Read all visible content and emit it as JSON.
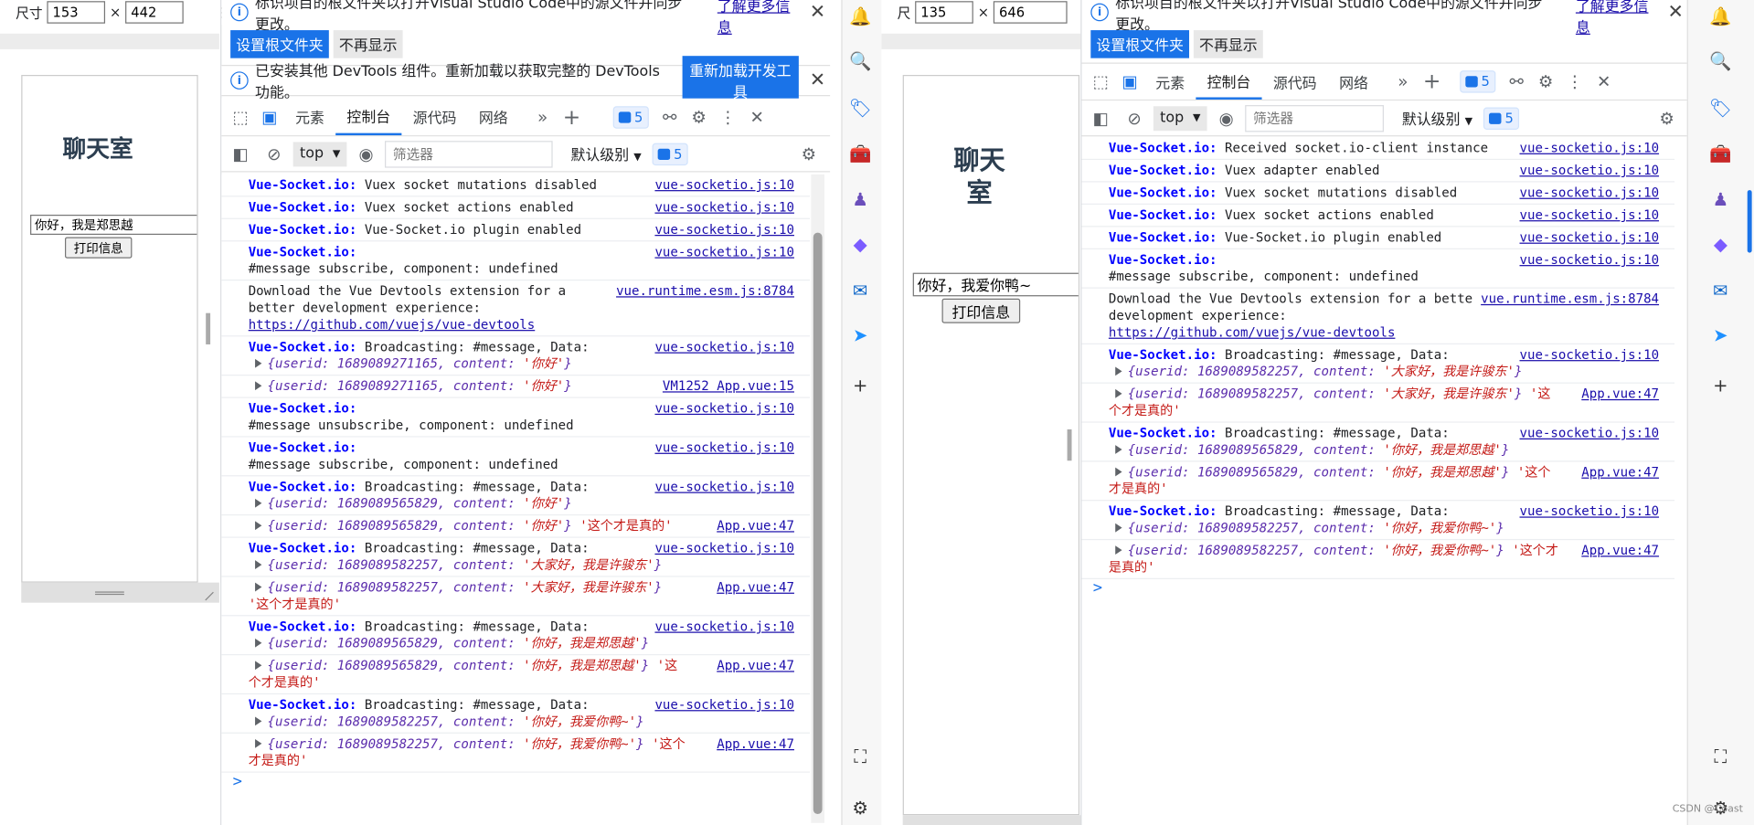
{
  "left_window": {
    "dim_label": "尺寸",
    "width": "153",
    "height": "442",
    "chat": {
      "title": "聊天室",
      "input_value": "你好，我是郑思越",
      "button": "打印信息"
    },
    "info1": {
      "text": "标识项目的根文件夹以打开Visual Studio Code中的源文件并同步更改。",
      "learn_more": "了解更多信息",
      "primary": "设置根文件夹",
      "secondary": "不再显示"
    },
    "info2": {
      "text": "已安装其他 DevTools 组件。重新加载以获取完整的 DevTools 功能。",
      "primary": "重新加载开发工具"
    },
    "tabs": [
      "元素",
      "控制台",
      "源代码",
      "网络"
    ],
    "active_tab": "控制台",
    "badge": "5",
    "context": "top",
    "filter_placeholder": "筛选器",
    "level": "默认级别",
    "filter_badge": "5",
    "console": [
      {
        "parts": [
          {
            "c": "vsio",
            "t": "Vue-Socket.io:"
          },
          {
            "c": "",
            "t": " Vuex socket mutations disabled"
          }
        ],
        "src": "vue-socketio.js:10"
      },
      {
        "parts": [
          {
            "c": "vsio",
            "t": "Vue-Socket.io:"
          },
          {
            "c": "",
            "t": " Vuex socket actions enabled"
          }
        ],
        "src": "vue-socketio.js:10"
      },
      {
        "parts": [
          {
            "c": "vsio",
            "t": "Vue-Socket.io:"
          },
          {
            "c": "",
            "t": " Vue-Socket.io plugin enabled"
          }
        ],
        "src": "vue-socketio.js:10"
      },
      {
        "parts": [
          {
            "c": "vsio",
            "t": "Vue-Socket.io:"
          },
          {
            "c": "",
            "t": "\n#message subscribe, component: undefined"
          }
        ],
        "src": "vue-socketio.js:10"
      },
      {
        "parts": [
          {
            "c": "",
            "t": "Download the Vue Devtools extension for a\nbetter development experience:\n"
          },
          {
            "c": "link",
            "t": "https://github.com/vuejs/vue-devtools"
          }
        ],
        "src": "vue.runtime.esm.js:8784"
      },
      {
        "parts": [
          {
            "c": "vsio",
            "t": "Vue-Socket.io:"
          },
          {
            "c": "",
            "t": " Broadcasting: #message, Data:\n"
          },
          {
            "c": "tri",
            "t": ""
          },
          {
            "c": "obj",
            "t": "{userid: 1689089271165, content: "
          },
          {
            "c": "str",
            "t": "'你好'"
          },
          {
            "c": "obj",
            "t": "}"
          }
        ],
        "src": "vue-socketio.js:10"
      },
      {
        "parts": [
          {
            "c": "tri",
            "t": ""
          },
          {
            "c": "obj",
            "t": "{userid: 1689089271165, content: "
          },
          {
            "c": "str",
            "t": "'你好'"
          },
          {
            "c": "obj",
            "t": "}"
          }
        ],
        "src": "VM1252 App.vue:15"
      },
      {
        "parts": [
          {
            "c": "vsio",
            "t": "Vue-Socket.io:"
          },
          {
            "c": "",
            "t": "\n#message unsubscribe, component: undefined"
          }
        ],
        "src": "vue-socketio.js:10"
      },
      {
        "parts": [
          {
            "c": "vsio",
            "t": "Vue-Socket.io:"
          },
          {
            "c": "",
            "t": "\n#message subscribe, component: undefined"
          }
        ],
        "src": "vue-socketio.js:10"
      },
      {
        "parts": [
          {
            "c": "vsio",
            "t": "Vue-Socket.io:"
          },
          {
            "c": "",
            "t": " Broadcasting: #message, Data:\n"
          },
          {
            "c": "tri",
            "t": ""
          },
          {
            "c": "obj",
            "t": "{userid: 1689089565829, content: "
          },
          {
            "c": "str",
            "t": "'你好'"
          },
          {
            "c": "obj",
            "t": "}"
          }
        ],
        "src": "vue-socketio.js:10"
      },
      {
        "parts": [
          {
            "c": "tri",
            "t": ""
          },
          {
            "c": "obj",
            "t": "{userid: 1689089565829, content: "
          },
          {
            "c": "str",
            "t": "'你好'"
          },
          {
            "c": "obj",
            "t": "}"
          },
          {
            "c": "plainstr",
            "t": " '这个才是真的'"
          }
        ],
        "src": "App.vue:47"
      },
      {
        "parts": [
          {
            "c": "vsio",
            "t": "Vue-Socket.io:"
          },
          {
            "c": "",
            "t": " Broadcasting: #message, Data:\n"
          },
          {
            "c": "tri",
            "t": ""
          },
          {
            "c": "obj",
            "t": "{userid: 1689089582257, content: "
          },
          {
            "c": "str",
            "t": "'大家好，我是许骏东'"
          },
          {
            "c": "obj",
            "t": "}"
          }
        ],
        "src": "vue-socketio.js:10"
      },
      {
        "parts": [
          {
            "c": "tri",
            "t": ""
          },
          {
            "c": "obj",
            "t": "{userid: 1689089582257, content: "
          },
          {
            "c": "str",
            "t": "'大家好，我是许骏东'"
          },
          {
            "c": "obj",
            "t": "}"
          },
          {
            "c": "plainstr",
            "t": "\n'这个才是真的'"
          }
        ],
        "src": "App.vue:47"
      },
      {
        "parts": [
          {
            "c": "vsio",
            "t": "Vue-Socket.io:"
          },
          {
            "c": "",
            "t": " Broadcasting: #message, Data:\n"
          },
          {
            "c": "tri",
            "t": ""
          },
          {
            "c": "obj",
            "t": "{userid: 1689089565829, content: "
          },
          {
            "c": "str",
            "t": "'你好，我是郑思越'"
          },
          {
            "c": "obj",
            "t": "}"
          }
        ],
        "src": "vue-socketio.js:10"
      },
      {
        "parts": [
          {
            "c": "tri",
            "t": ""
          },
          {
            "c": "obj",
            "t": "{userid: 1689089565829, content: "
          },
          {
            "c": "str",
            "t": "'你好，我是郑思越'"
          },
          {
            "c": "obj",
            "t": "}"
          },
          {
            "c": "plainstr",
            "t": " '这\n个才是真的'"
          }
        ],
        "src": "App.vue:47"
      },
      {
        "parts": [
          {
            "c": "vsio",
            "t": "Vue-Socket.io:"
          },
          {
            "c": "",
            "t": " Broadcasting: #message, Data:\n"
          },
          {
            "c": "tri",
            "t": ""
          },
          {
            "c": "obj",
            "t": "{userid: 1689089582257, content: "
          },
          {
            "c": "str",
            "t": "'你好，我爱你鸭~'"
          },
          {
            "c": "obj",
            "t": "}"
          }
        ],
        "src": "vue-socketio.js:10"
      },
      {
        "parts": [
          {
            "c": "tri",
            "t": ""
          },
          {
            "c": "obj",
            "t": "{userid: 1689089582257, content: "
          },
          {
            "c": "str",
            "t": "'你好，我爱你鸭~'"
          },
          {
            "c": "obj",
            "t": "}"
          },
          {
            "c": "plainstr",
            "t": " '这个\n才是真的'"
          }
        ],
        "src": "App.vue:47"
      }
    ],
    "prompt": ">"
  },
  "right_window": {
    "dim_label": "尺",
    "width": "135",
    "height": "646",
    "chat": {
      "title": "聊天室",
      "input_value": "你好，我爱你鸭~",
      "button": "打印信息"
    },
    "info1": {
      "text": "标识项目的根文件夹以打开Visual Studio Code中的源文件并同步更改。",
      "learn_more": "了解更多信息",
      "primary": "设置根文件夹",
      "secondary": "不再显示"
    },
    "tabs": [
      "元素",
      "控制台",
      "源代码",
      "网络"
    ],
    "active_tab": "控制台",
    "badge": "5",
    "context": "top",
    "filter_placeholder": "筛选器",
    "level": "默认级别",
    "filter_badge": "5",
    "console": [
      {
        "parts": [
          {
            "c": "vsio",
            "t": "Vue-Socket.io:"
          },
          {
            "c": "",
            "t": " Received socket.io-client instance"
          }
        ],
        "src": "vue-socketio.js:10"
      },
      {
        "parts": [
          {
            "c": "vsio",
            "t": "Vue-Socket.io:"
          },
          {
            "c": "",
            "t": " Vuex adapter enabled"
          }
        ],
        "src": "vue-socketio.js:10"
      },
      {
        "parts": [
          {
            "c": "vsio",
            "t": "Vue-Socket.io:"
          },
          {
            "c": "",
            "t": " Vuex socket mutations disabled"
          }
        ],
        "src": "vue-socketio.js:10"
      },
      {
        "parts": [
          {
            "c": "vsio",
            "t": "Vue-Socket.io:"
          },
          {
            "c": "",
            "t": " Vuex socket actions enabled"
          }
        ],
        "src": "vue-socketio.js:10"
      },
      {
        "parts": [
          {
            "c": "vsio",
            "t": "Vue-Socket.io:"
          },
          {
            "c": "",
            "t": " Vue-Socket.io plugin enabled"
          }
        ],
        "src": "vue-socketio.js:10"
      },
      {
        "parts": [
          {
            "c": "vsio",
            "t": "Vue-Socket.io:"
          },
          {
            "c": "",
            "t": "\n#message subscribe, component: undefined"
          }
        ],
        "src": "vue-socketio.js:10"
      },
      {
        "parts": [
          {
            "c": "",
            "t": "Download the Vue Devtools extension for a better\ndevelopment experience:\n"
          },
          {
            "c": "link",
            "t": "https://github.com/vuejs/vue-devtools"
          }
        ],
        "src": "vue.runtime.esm.js:8784"
      },
      {
        "parts": [
          {
            "c": "vsio",
            "t": "Vue-Socket.io:"
          },
          {
            "c": "",
            "t": " Broadcasting: #message, Data:\n"
          },
          {
            "c": "tri",
            "t": ""
          },
          {
            "c": "obj",
            "t": "{userid: 1689089582257, content: "
          },
          {
            "c": "str",
            "t": "'大家好，我是许骏东'"
          },
          {
            "c": "obj",
            "t": "}"
          }
        ],
        "src": "vue-socketio.js:10"
      },
      {
        "parts": [
          {
            "c": "tri",
            "t": ""
          },
          {
            "c": "obj",
            "t": "{userid: 1689089582257, content: "
          },
          {
            "c": "str",
            "t": "'大家好，我是许骏东'"
          },
          {
            "c": "obj",
            "t": "}"
          },
          {
            "c": "plainstr",
            "t": " '这\n个才是真的'"
          }
        ],
        "src": "App.vue:47"
      },
      {
        "parts": [
          {
            "c": "vsio",
            "t": "Vue-Socket.io:"
          },
          {
            "c": "",
            "t": " Broadcasting: #message, Data:\n"
          },
          {
            "c": "tri",
            "t": ""
          },
          {
            "c": "obj",
            "t": "{userid: 1689089565829, content: "
          },
          {
            "c": "str",
            "t": "'你好，我是郑思越'"
          },
          {
            "c": "obj",
            "t": "}"
          }
        ],
        "src": "vue-socketio.js:10"
      },
      {
        "parts": [
          {
            "c": "tri",
            "t": ""
          },
          {
            "c": "obj",
            "t": "{userid: 1689089565829, content: "
          },
          {
            "c": "str",
            "t": "'你好，我是郑思越'"
          },
          {
            "c": "obj",
            "t": "}"
          },
          {
            "c": "plainstr",
            "t": " '这个\n才是真的'"
          }
        ],
        "src": "App.vue:47"
      },
      {
        "parts": [
          {
            "c": "vsio",
            "t": "Vue-Socket.io:"
          },
          {
            "c": "",
            "t": " Broadcasting: #message, Data:\n"
          },
          {
            "c": "tri",
            "t": ""
          },
          {
            "c": "obj",
            "t": "{userid: 1689089582257, content: "
          },
          {
            "c": "str",
            "t": "'你好，我爱你鸭~'"
          },
          {
            "c": "obj",
            "t": "}"
          }
        ],
        "src": "vue-socketio.js:10"
      },
      {
        "parts": [
          {
            "c": "tri",
            "t": ""
          },
          {
            "c": "obj",
            "t": "{userid: 1689089582257, content: "
          },
          {
            "c": "str",
            "t": "'你好，我爱你鸭~'"
          },
          {
            "c": "obj",
            "t": "}"
          },
          {
            "c": "plainstr",
            "t": " '这个才\n是真的'"
          }
        ],
        "src": "App.vue:47"
      }
    ],
    "prompt": ">"
  },
  "sidebar_icons": [
    "bell-icon",
    "search-icon",
    "tag-icon",
    "toolbox-icon",
    "chess-icon",
    "copilot-icon",
    "outlook-icon",
    "send-icon",
    "plus-icon",
    "screenshot-icon",
    "gear-icon"
  ],
  "watermark": "CSDN @Coast"
}
